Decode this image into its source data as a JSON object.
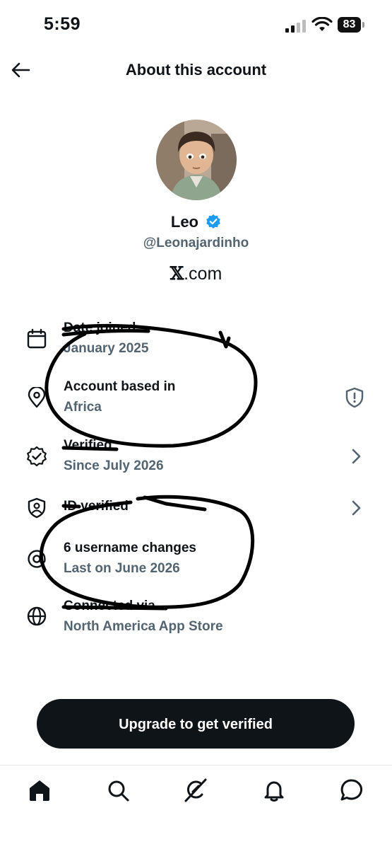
{
  "status_bar": {
    "time": "5:59",
    "battery": "83"
  },
  "header": {
    "title": "About this account"
  },
  "profile": {
    "name": "Leo",
    "handle": "@Leonajardinho",
    "site_prefix": "𝕏",
    "site_suffix": ".com"
  },
  "details": [
    {
      "title": "Date joined",
      "subtitle": "January 2025",
      "icon": "calendar-icon"
    },
    {
      "title": "Account based in",
      "subtitle": "Africa",
      "icon": "location-pin-icon",
      "trailing": "shield-alert-icon"
    },
    {
      "title": "Verified",
      "subtitle": "Since July 2026",
      "icon": "verified-badge-icon",
      "trailing": "chevron-right-icon"
    },
    {
      "title": "ID verified",
      "subtitle": "",
      "icon": "id-shield-icon",
      "trailing": "chevron-right-icon"
    },
    {
      "title": "6 username changes",
      "subtitle": "Last on June 2026",
      "icon": "at-sign-icon"
    },
    {
      "title": "Connected via",
      "subtitle": "North America App Store",
      "icon": "globe-icon"
    }
  ],
  "cta": {
    "label": "Upgrade to get verified"
  },
  "bottom_nav": [
    "home-icon",
    "search-icon",
    "grok-icon",
    "notifications-icon",
    "messages-icon"
  ],
  "colors": {
    "text": "#0f1419",
    "secondary": "#536471",
    "verified": "#1d9bf0"
  }
}
